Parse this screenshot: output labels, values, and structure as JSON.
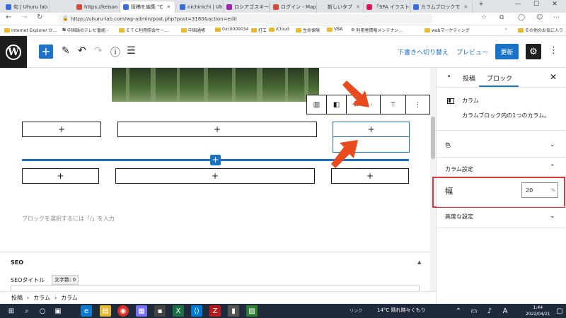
{
  "browser": {
    "tabs": [
      {
        "label": "旬 | Uhuru lab",
        "color": "#3a6fd8"
      },
      {
        "label": "https://keisan",
        "color": "#d84a3a"
      },
      {
        "label": "投稿を編集 \"C",
        "color": "#3a6fd8",
        "active": true
      },
      {
        "label": "nichinichi | Uh",
        "color": "#3a6fd8"
      },
      {
        "label": "ロシアゴスキー田",
        "color": "#9c27b0"
      },
      {
        "label": "ログイン - Maple",
        "color": "#d84a3a"
      },
      {
        "label": "新しいタブ",
        "color": "#e0e0e0"
      },
      {
        "label": "「SFA イラスト」",
        "color": "#d81b60"
      },
      {
        "label": "カラムブロックで",
        "color": "#3a6fd8"
      }
    ],
    "url": "https://uhuru-lab.com/wp-admin/post.php?post=3180&action=edit",
    "bookmarks": [
      "Internet Explorer か...",
      "中国語のテレビ番組 -",
      "ＥＴＣ利用照会サー...",
      "中国通帳",
      "0xc0000034",
      "打工",
      "iCloud",
      "生命保険",
      "VBA",
      "利用者情報メンテナン...",
      "webマーケティング",
      "その他のお気に入り"
    ]
  },
  "wp_toolbar": {
    "draft_label": "下書きへ切り替え",
    "preview_label": "プレビュー",
    "update_label": "更新"
  },
  "editor": {
    "placeholder": "ブロックを選択するには「/」を入力",
    "plus": "+"
  },
  "seo": {
    "title": "SEO",
    "field_label": "SEOタイトル",
    "char_count": "文字数: 0"
  },
  "breadcrumb": [
    "投稿",
    "カラム",
    "カラム"
  ],
  "sidebar": {
    "tab_post": "投稿",
    "tab_block": "ブロック",
    "block_name": "カラム",
    "block_desc": "カラムブロック内の1つのカラム。",
    "section_color": "色",
    "section_column_settings": "カラム設定",
    "width_label": "幅",
    "width_value": "20",
    "width_unit": "%",
    "section_advanced": "高度な設定"
  },
  "taskbar": {
    "link_label": "リンク",
    "weather": "14°C 晴れ時々くもり",
    "time": "1:44",
    "date": "2022/04/21"
  },
  "colors": {
    "accent": "#1a73c8",
    "highlight": "#d9363e",
    "arrow": "#e84c1e"
  }
}
